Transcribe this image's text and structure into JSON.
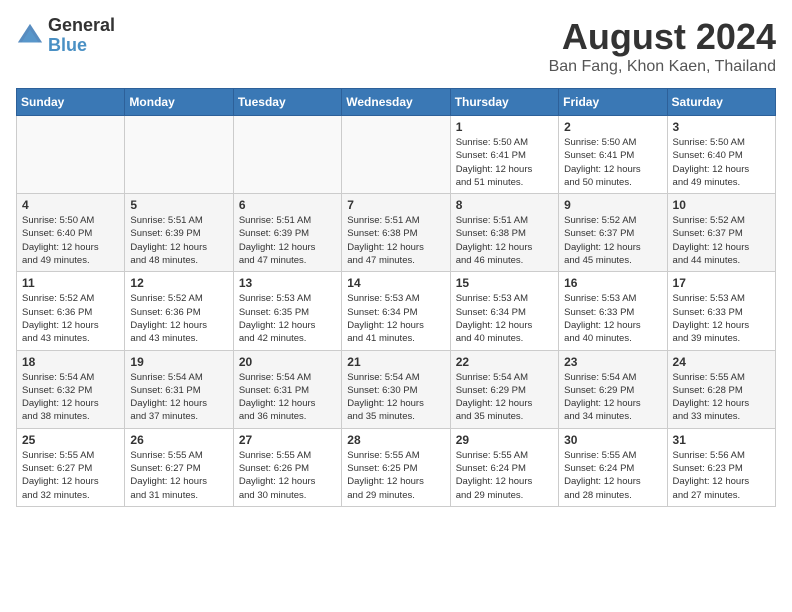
{
  "header": {
    "logo_general": "General",
    "logo_blue": "Blue",
    "title": "August 2024",
    "subtitle": "Ban Fang, Khon Kaen, Thailand"
  },
  "days_of_week": [
    "Sunday",
    "Monday",
    "Tuesday",
    "Wednesday",
    "Thursday",
    "Friday",
    "Saturday"
  ],
  "weeks": [
    [
      {
        "day": "",
        "info": ""
      },
      {
        "day": "",
        "info": ""
      },
      {
        "day": "",
        "info": ""
      },
      {
        "day": "",
        "info": ""
      },
      {
        "day": "1",
        "info": "Sunrise: 5:50 AM\nSunset: 6:41 PM\nDaylight: 12 hours\nand 51 minutes."
      },
      {
        "day": "2",
        "info": "Sunrise: 5:50 AM\nSunset: 6:41 PM\nDaylight: 12 hours\nand 50 minutes."
      },
      {
        "day": "3",
        "info": "Sunrise: 5:50 AM\nSunset: 6:40 PM\nDaylight: 12 hours\nand 49 minutes."
      }
    ],
    [
      {
        "day": "4",
        "info": "Sunrise: 5:50 AM\nSunset: 6:40 PM\nDaylight: 12 hours\nand 49 minutes."
      },
      {
        "day": "5",
        "info": "Sunrise: 5:51 AM\nSunset: 6:39 PM\nDaylight: 12 hours\nand 48 minutes."
      },
      {
        "day": "6",
        "info": "Sunrise: 5:51 AM\nSunset: 6:39 PM\nDaylight: 12 hours\nand 47 minutes."
      },
      {
        "day": "7",
        "info": "Sunrise: 5:51 AM\nSunset: 6:38 PM\nDaylight: 12 hours\nand 47 minutes."
      },
      {
        "day": "8",
        "info": "Sunrise: 5:51 AM\nSunset: 6:38 PM\nDaylight: 12 hours\nand 46 minutes."
      },
      {
        "day": "9",
        "info": "Sunrise: 5:52 AM\nSunset: 6:37 PM\nDaylight: 12 hours\nand 45 minutes."
      },
      {
        "day": "10",
        "info": "Sunrise: 5:52 AM\nSunset: 6:37 PM\nDaylight: 12 hours\nand 44 minutes."
      }
    ],
    [
      {
        "day": "11",
        "info": "Sunrise: 5:52 AM\nSunset: 6:36 PM\nDaylight: 12 hours\nand 43 minutes."
      },
      {
        "day": "12",
        "info": "Sunrise: 5:52 AM\nSunset: 6:36 PM\nDaylight: 12 hours\nand 43 minutes."
      },
      {
        "day": "13",
        "info": "Sunrise: 5:53 AM\nSunset: 6:35 PM\nDaylight: 12 hours\nand 42 minutes."
      },
      {
        "day": "14",
        "info": "Sunrise: 5:53 AM\nSunset: 6:34 PM\nDaylight: 12 hours\nand 41 minutes."
      },
      {
        "day": "15",
        "info": "Sunrise: 5:53 AM\nSunset: 6:34 PM\nDaylight: 12 hours\nand 40 minutes."
      },
      {
        "day": "16",
        "info": "Sunrise: 5:53 AM\nSunset: 6:33 PM\nDaylight: 12 hours\nand 40 minutes."
      },
      {
        "day": "17",
        "info": "Sunrise: 5:53 AM\nSunset: 6:33 PM\nDaylight: 12 hours\nand 39 minutes."
      }
    ],
    [
      {
        "day": "18",
        "info": "Sunrise: 5:54 AM\nSunset: 6:32 PM\nDaylight: 12 hours\nand 38 minutes."
      },
      {
        "day": "19",
        "info": "Sunrise: 5:54 AM\nSunset: 6:31 PM\nDaylight: 12 hours\nand 37 minutes."
      },
      {
        "day": "20",
        "info": "Sunrise: 5:54 AM\nSunset: 6:31 PM\nDaylight: 12 hours\nand 36 minutes."
      },
      {
        "day": "21",
        "info": "Sunrise: 5:54 AM\nSunset: 6:30 PM\nDaylight: 12 hours\nand 35 minutes."
      },
      {
        "day": "22",
        "info": "Sunrise: 5:54 AM\nSunset: 6:29 PM\nDaylight: 12 hours\nand 35 minutes."
      },
      {
        "day": "23",
        "info": "Sunrise: 5:54 AM\nSunset: 6:29 PM\nDaylight: 12 hours\nand 34 minutes."
      },
      {
        "day": "24",
        "info": "Sunrise: 5:55 AM\nSunset: 6:28 PM\nDaylight: 12 hours\nand 33 minutes."
      }
    ],
    [
      {
        "day": "25",
        "info": "Sunrise: 5:55 AM\nSunset: 6:27 PM\nDaylight: 12 hours\nand 32 minutes."
      },
      {
        "day": "26",
        "info": "Sunrise: 5:55 AM\nSunset: 6:27 PM\nDaylight: 12 hours\nand 31 minutes."
      },
      {
        "day": "27",
        "info": "Sunrise: 5:55 AM\nSunset: 6:26 PM\nDaylight: 12 hours\nand 30 minutes."
      },
      {
        "day": "28",
        "info": "Sunrise: 5:55 AM\nSunset: 6:25 PM\nDaylight: 12 hours\nand 29 minutes."
      },
      {
        "day": "29",
        "info": "Sunrise: 5:55 AM\nSunset: 6:24 PM\nDaylight: 12 hours\nand 29 minutes."
      },
      {
        "day": "30",
        "info": "Sunrise: 5:55 AM\nSunset: 6:24 PM\nDaylight: 12 hours\nand 28 minutes."
      },
      {
        "day": "31",
        "info": "Sunrise: 5:56 AM\nSunset: 6:23 PM\nDaylight: 12 hours\nand 27 minutes."
      }
    ]
  ]
}
